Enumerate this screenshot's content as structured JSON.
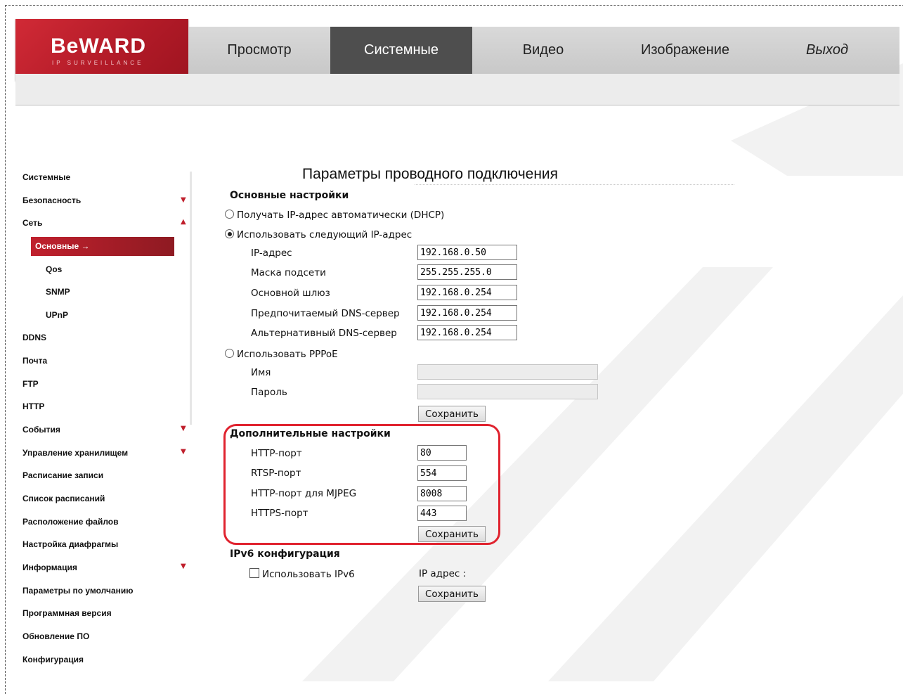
{
  "logo": {
    "brand": "BeWARD",
    "sub": "IP SURVEILLANCE"
  },
  "nav": {
    "tabs": [
      {
        "label": "Просмотр",
        "active": false
      },
      {
        "label": "Системные",
        "active": true
      },
      {
        "label": "Видео",
        "active": false
      },
      {
        "label": "Изображение",
        "active": false
      },
      {
        "label": "Выход",
        "active": false
      }
    ]
  },
  "sidebar": {
    "items": [
      {
        "label": "Системные"
      },
      {
        "label": "Безопасность",
        "icon": "arrow-down-icon"
      },
      {
        "label": "Сеть",
        "icon": "arrow-up-icon"
      },
      {
        "label": "Основные →",
        "active": true
      },
      {
        "label": "Qos"
      },
      {
        "label": "SNMP"
      },
      {
        "label": "UPnP"
      },
      {
        "label": "DDNS"
      },
      {
        "label": "Почта"
      },
      {
        "label": "FTP"
      },
      {
        "label": "HTTP"
      },
      {
        "label": "События",
        "icon": "arrow-down-icon"
      },
      {
        "label": "Управление хранилищем",
        "icon": "arrow-down-icon"
      },
      {
        "label": "Расписание записи"
      },
      {
        "label": "Список расписаний"
      },
      {
        "label": "Расположение файлов"
      },
      {
        "label": "Настройка диафрагмы"
      },
      {
        "label": "Информация",
        "icon": "arrow-down-icon"
      },
      {
        "label": "Параметры по умолчанию"
      },
      {
        "label": "Программная версия"
      },
      {
        "label": "Обновление ПО"
      },
      {
        "label": "Конфигурация"
      }
    ]
  },
  "page": {
    "title": "Параметры проводного подключения"
  },
  "basic": {
    "heading": "Основные настройки",
    "dhcp_label": "Получать IP-адрес автоматически (DHCP)",
    "static_label": "Использовать следующий IP-адрес",
    "fields": [
      {
        "label": "IP-адрес",
        "value": "192.168.0.50"
      },
      {
        "label": "Маска подсети",
        "value": "255.255.255.0"
      },
      {
        "label": "Основной шлюз",
        "value": "192.168.0.254"
      },
      {
        "label": "Предпочитаемый DNS-сервер",
        "value": "192.168.0.254"
      },
      {
        "label": "Альтернативный DNS-сервер",
        "value": "192.168.0.254"
      }
    ],
    "pppoe_label": "Использовать PPPoE",
    "pppoe_name_label": "Имя",
    "pppoe_password_label": "Пароль",
    "save_label": "Сохранить"
  },
  "advanced": {
    "heading": "Дополнительные настройки",
    "fields": [
      {
        "label": "HTTP-порт",
        "value": "80"
      },
      {
        "label": "RTSP-порт",
        "value": "554"
      },
      {
        "label": "HTTP-порт для MJPEG",
        "value": "8008"
      },
      {
        "label": "HTTPS-порт",
        "value": "443"
      }
    ],
    "save_label": "Сохранить"
  },
  "ipv6": {
    "heading": "IPv6 конфигурация",
    "checkbox_label": "Использовать IPv6",
    "address_label": "IP адрес :",
    "save_label": "Сохранить"
  },
  "colors": {
    "accent": "#c0202d",
    "nav_active": "#4e4e4e",
    "highlight": "#e0232f"
  }
}
